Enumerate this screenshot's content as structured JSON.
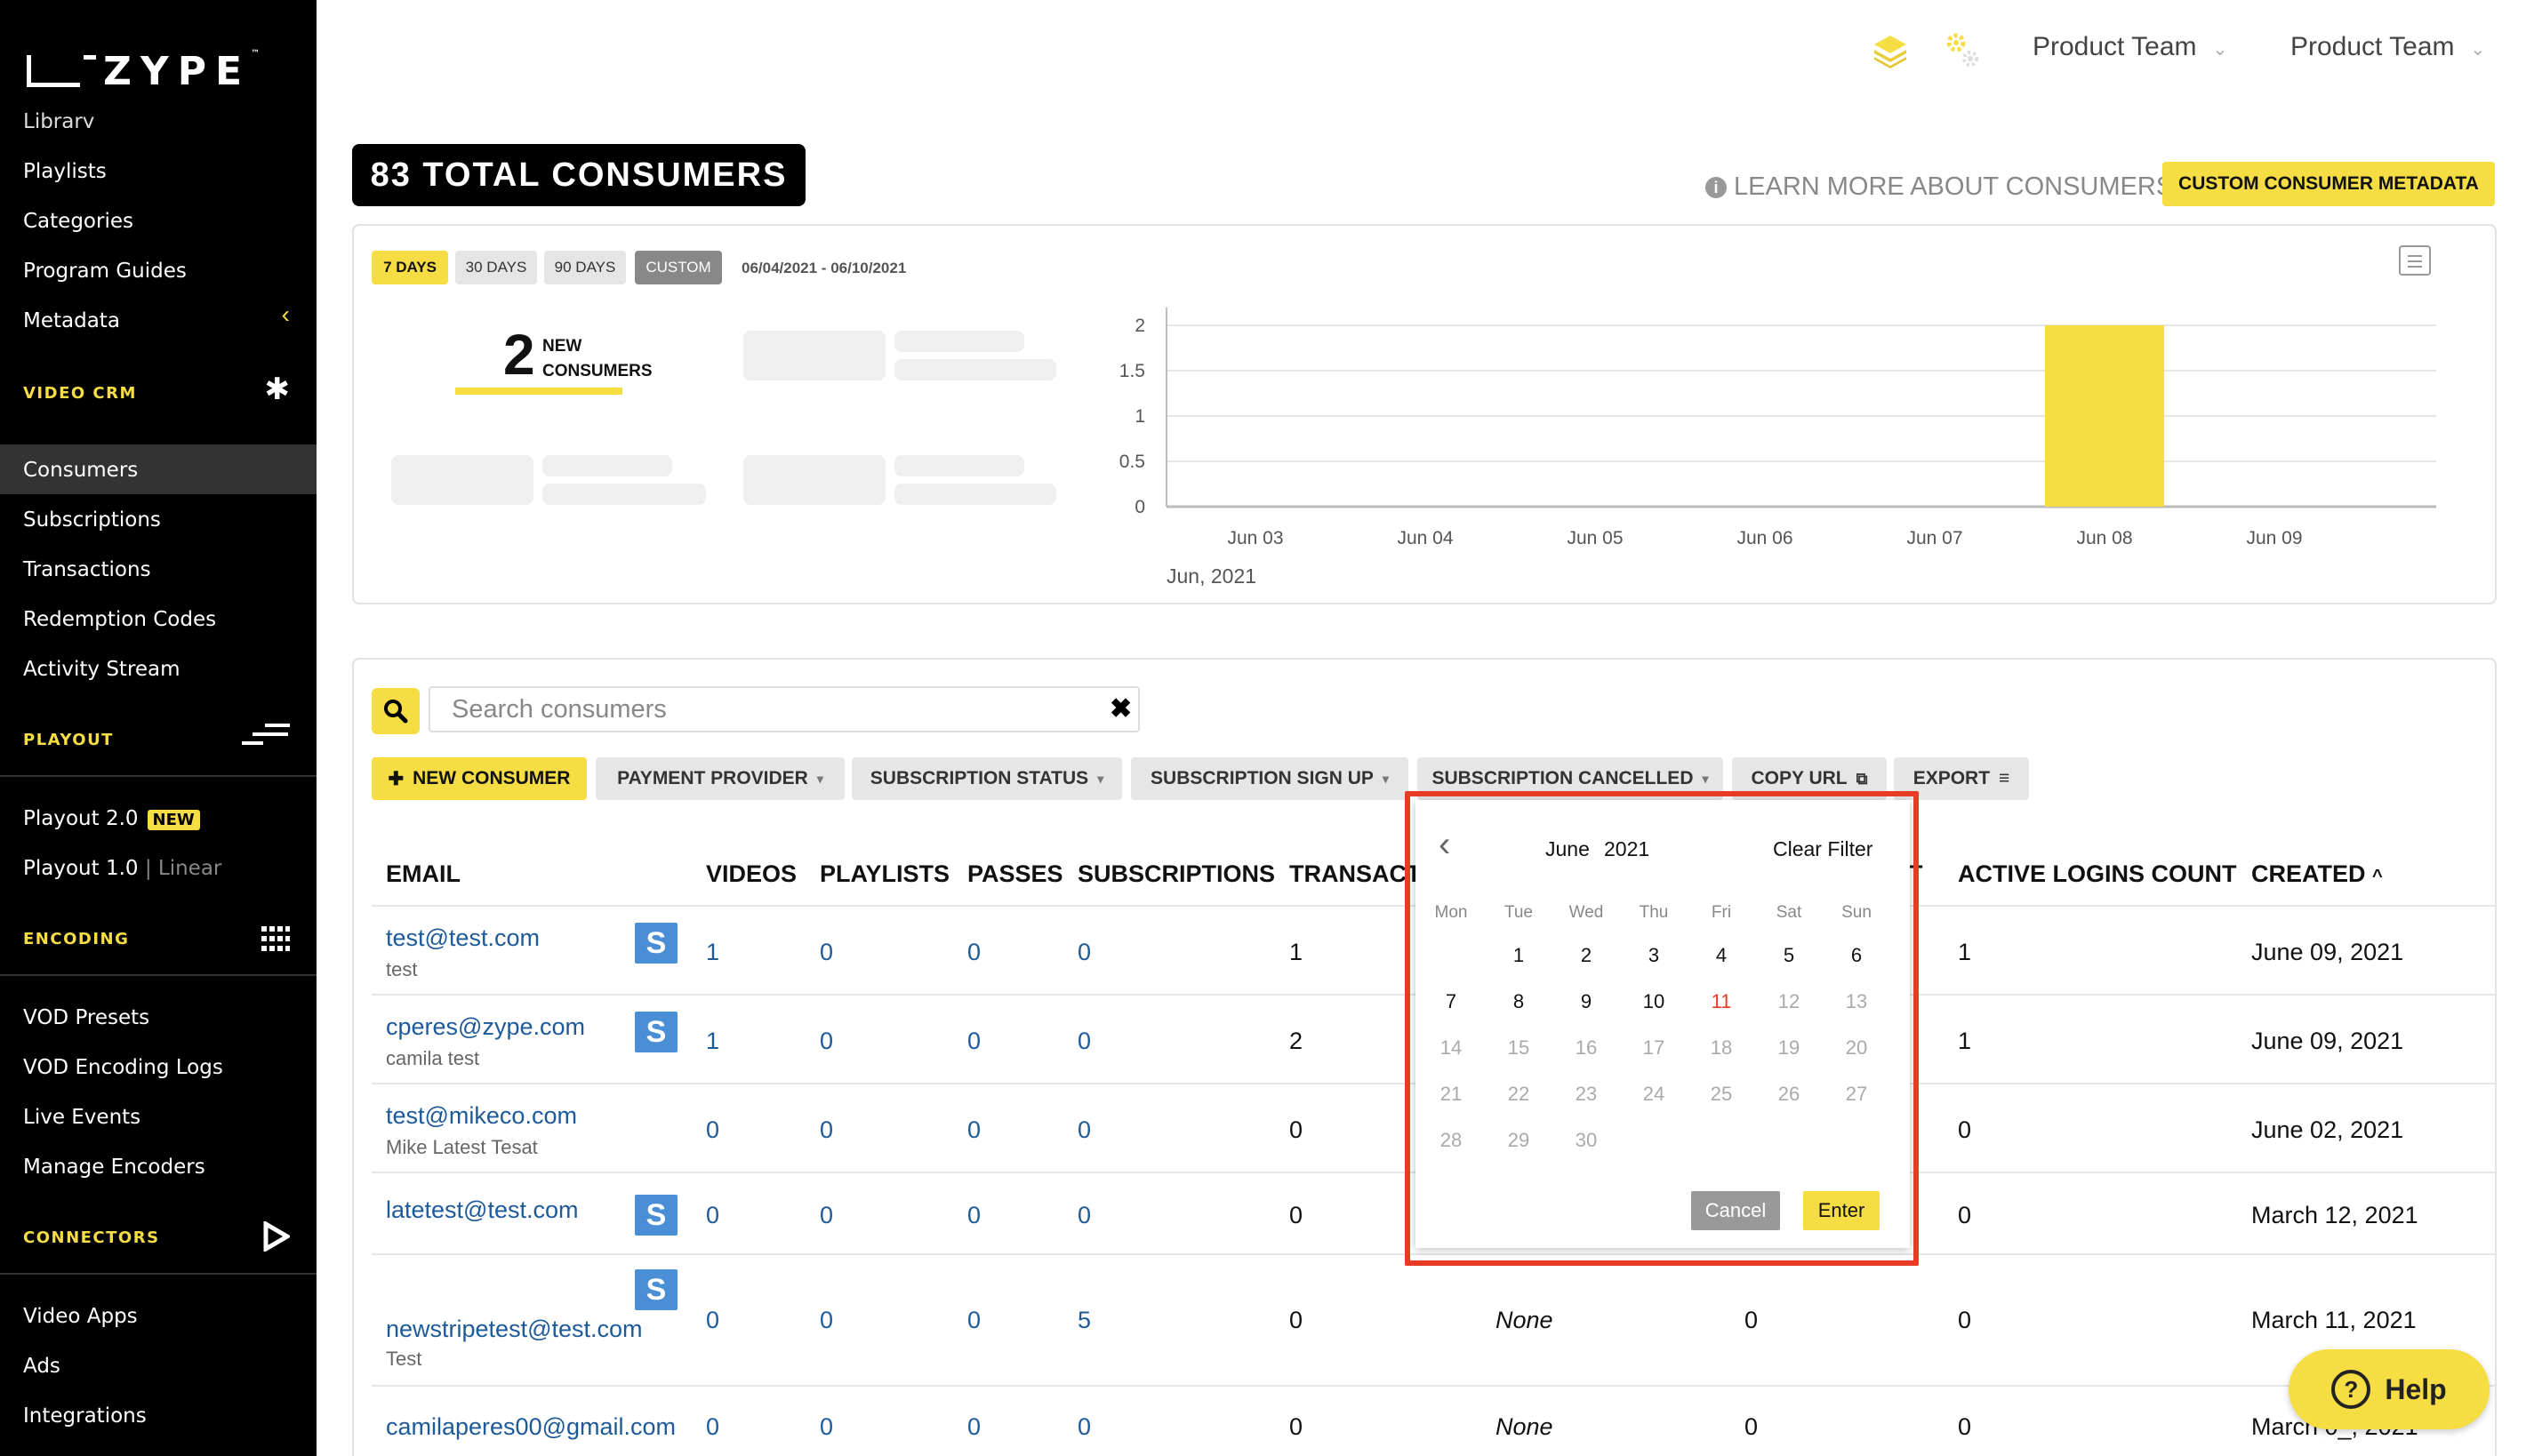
{
  "brand": {
    "name": "ZYPE",
    "tm": "™",
    "accent": "#f5dd43",
    "alert": "#e63b24"
  },
  "sidebar": {
    "items_top": [
      {
        "label": "Library"
      },
      {
        "label": "Playlists"
      },
      {
        "label": "Categories"
      },
      {
        "label": "Program Guides"
      },
      {
        "label": "Metadata"
      }
    ],
    "sections": {
      "video_crm": "VIDEO CRM",
      "playout": "PLAYOUT",
      "encoding": "ENCODING",
      "connectors": "CONNECTORS"
    },
    "crm_items": [
      {
        "label": "Consumers"
      },
      {
        "label": "Subscriptions"
      },
      {
        "label": "Transactions"
      },
      {
        "label": "Redemption Codes"
      },
      {
        "label": "Activity Stream"
      }
    ],
    "playout_items": [
      {
        "label": "Playout 2.0",
        "badge": "NEW"
      },
      {
        "label": "Playout 1.0",
        "suffix": "| Linear"
      }
    ],
    "encoding_items": [
      {
        "label": "VOD Presets"
      },
      {
        "label": "VOD Encoding Logs"
      },
      {
        "label": "Live Events"
      },
      {
        "label": "Manage Encoders"
      }
    ],
    "connectors_items": [
      {
        "label": "Video Apps"
      },
      {
        "label": "Ads"
      },
      {
        "label": "Integrations"
      }
    ]
  },
  "topbar": {
    "team_1": "Product Team",
    "team_2": "Product Team"
  },
  "header": {
    "total_consumers": "83 TOTAL CONSUMERS",
    "learn_more": "LEARN MORE ABOUT CONSUMERS",
    "custom_metadata": "CUSTOM CONSUMER METADATA"
  },
  "stats": {
    "ranges": [
      "7 DAYS",
      "30 DAYS",
      "90 DAYS",
      "CUSTOM"
    ],
    "selected_range": "7 DAYS",
    "date_range": "06/04/2021 - 06/10/2021",
    "new_count": "2",
    "new_label_1": "NEW",
    "new_label_2": "CONSUMERS"
  },
  "chart_data": {
    "type": "bar",
    "categories": [
      "Jun 03",
      "Jun 04",
      "Jun 05",
      "Jun 06",
      "Jun 07",
      "Jun 08",
      "Jun 09"
    ],
    "values": [
      0,
      0,
      0,
      0,
      0,
      2,
      0
    ],
    "yticks": [
      "0",
      "0.5",
      "1",
      "1.5",
      "2"
    ],
    "ylim": [
      0,
      2
    ],
    "x_group_label": "Jun, 2021",
    "bar_color": "#f5dd43",
    "grid": true
  },
  "search": {
    "placeholder": "Search consumers"
  },
  "filters": {
    "new_consumer": "NEW CONSUMER",
    "payment_provider": "PAYMENT PROVIDER",
    "subscription_status": "SUBSCRIPTION STATUS",
    "subscription_sign_up": "SUBSCRIPTION SIGN UP",
    "subscription_cancelled": "SUBSCRIPTION CANCELLED",
    "copy_url": "COPY URL",
    "export": "EXPORT"
  },
  "table": {
    "columns": {
      "email": "EMAIL",
      "videos": "VIDEOS",
      "playlists": "PLAYLISTS",
      "passes": "PASSES",
      "subscriptions": "SUBSCRIPTIONS",
      "transactions": "TRANSACTI",
      "hidden_col_end": "T",
      "active_logins": "ACTIVE LOGINS COUNT",
      "created": "CREATED"
    },
    "rows": [
      {
        "email": "test@test.com",
        "name": "test",
        "stripe": true,
        "videos": "1",
        "playlists": "0",
        "passes": "0",
        "subscriptions": "0",
        "transactions": "1",
        "other": "",
        "other2": "",
        "logins": "1",
        "created": "June 09, 2021"
      },
      {
        "email": "cperes@zype.com",
        "name": "camila test",
        "stripe": true,
        "videos": "1",
        "playlists": "0",
        "passes": "0",
        "subscriptions": "0",
        "transactions": "2",
        "other": "",
        "other2": "",
        "logins": "1",
        "created": "June 09, 2021"
      },
      {
        "email": "test@mikeco.com",
        "name": "Mike Latest Tesat",
        "stripe": false,
        "videos": "0",
        "playlists": "0",
        "passes": "0",
        "subscriptions": "0",
        "transactions": "0",
        "other": "",
        "other2": "",
        "logins": "0",
        "created": "June 02, 2021"
      },
      {
        "email": "latetest@test.com",
        "name": "",
        "stripe": true,
        "videos": "0",
        "playlists": "0",
        "passes": "0",
        "subscriptions": "0",
        "transactions": "0",
        "other": "",
        "other2": "",
        "logins": "0",
        "created": "March 12, 2021"
      },
      {
        "email": "newstripetest@test.com",
        "name": "Test",
        "stripe": true,
        "videos": "0",
        "playlists": "0",
        "passes": "0",
        "subscriptions": "5",
        "transactions": "0",
        "other": "None",
        "other2": "0",
        "logins": "0",
        "created": "March 11, 2021"
      },
      {
        "email": "camilaperes00@gmail.com",
        "name": "",
        "stripe": false,
        "videos": "0",
        "playlists": "0",
        "passes": "0",
        "subscriptions": "0",
        "transactions": "0",
        "other": "None",
        "other2": "0",
        "logins": "0",
        "created": "March 0_, 2021"
      }
    ]
  },
  "datepicker": {
    "month": "June",
    "year": "2021",
    "clear": "Clear Filter",
    "weekdays": [
      "Mon",
      "Tue",
      "Wed",
      "Thu",
      "Fri",
      "Sat",
      "Sun"
    ],
    "weeks": [
      [
        "",
        "1",
        "2",
        "3",
        "4",
        "5",
        "6"
      ],
      [
        "7",
        "8",
        "9",
        "10",
        "11",
        "12",
        "13"
      ],
      [
        "14",
        "15",
        "16",
        "17",
        "18",
        "19",
        "20"
      ],
      [
        "21",
        "22",
        "23",
        "24",
        "25",
        "26",
        "27"
      ],
      [
        "28",
        "29",
        "30",
        "",
        "",
        "",
        ""
      ]
    ],
    "today": "11",
    "last_enabled": 11,
    "cancel": "Cancel",
    "enter": "Enter"
  },
  "help": {
    "label": "Help"
  }
}
